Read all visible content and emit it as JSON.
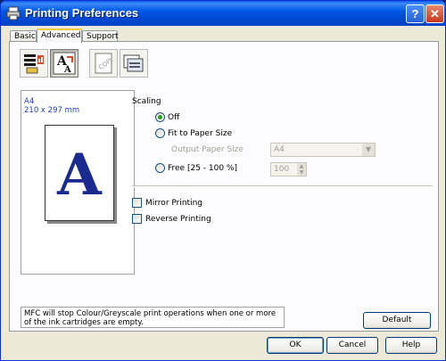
{
  "window": {
    "title": "Printing Preferences",
    "help_button": "?",
    "close_button": "✕"
  },
  "tabs": [
    {
      "label": "Basic",
      "active": false
    },
    {
      "label": "Advanced",
      "active": true
    },
    {
      "label": "Support",
      "active": false
    }
  ],
  "toolbar": {
    "icons": [
      "document-settings-icon",
      "scaling-icon",
      "copy-watermark-icon",
      "print-options-icon"
    ],
    "selected_index": 1
  },
  "preview": {
    "paper_name": "A4",
    "paper_dims": "210 x 297 mm",
    "letter": "A"
  },
  "scaling": {
    "label": "Scaling",
    "options": [
      {
        "label": "Off",
        "selected": true
      },
      {
        "label": "Fit to Paper Size",
        "selected": false
      },
      {
        "label": "Free [25 - 100 %]",
        "selected": false
      }
    ],
    "output_paper_size_label": "Output Paper Size",
    "output_paper_size_value": "A4",
    "free_value": "100"
  },
  "checkboxes": {
    "mirror_printing": {
      "label": "Mirror Printing",
      "checked": false
    },
    "reverse_printing": {
      "label": "Reverse Printing",
      "checked": false
    }
  },
  "message": "MFC will stop Colour/Greyscale print operations when one or more of the ink cartridges are empty.",
  "buttons": {
    "default": "Default",
    "ok": "OK",
    "cancel": "Cancel",
    "help": "Help"
  },
  "colors": {
    "titlebar": "#0058e6",
    "dialog_bg": "#ece9d8",
    "radio_dot": "#21a121",
    "preview_text": "#1a3cc8"
  }
}
